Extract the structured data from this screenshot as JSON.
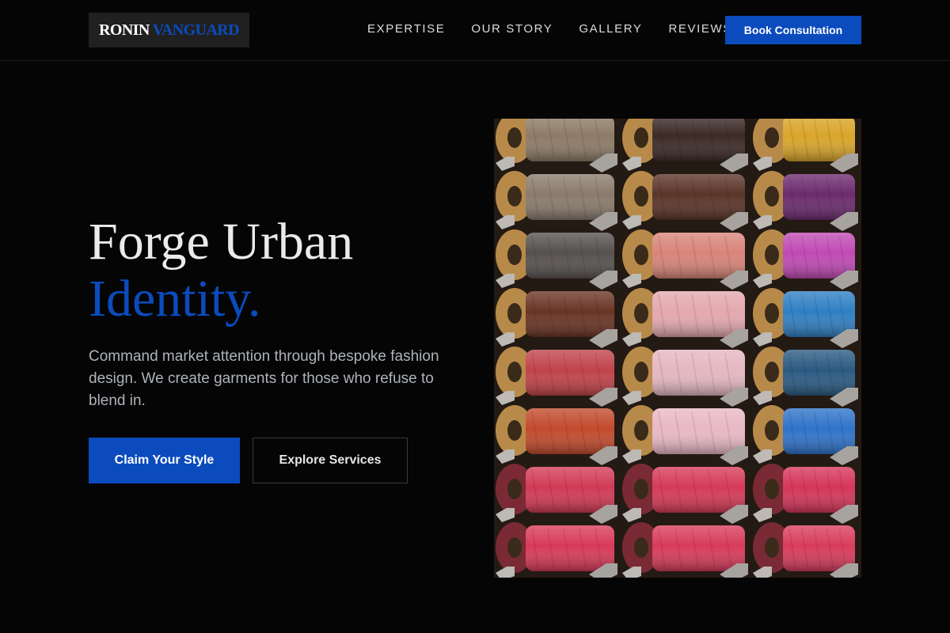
{
  "brand": {
    "part1": "RONIN",
    "part2": "VANGUARD",
    "accent_color": "#0b4bbd"
  },
  "nav": {
    "items": [
      {
        "label": "EXPERTISE"
      },
      {
        "label": "OUR STORY"
      },
      {
        "label": "GALLERY"
      },
      {
        "label": "REVIEWS"
      }
    ],
    "cta_label": "Book Consultation"
  },
  "hero": {
    "title_line1": "Forge Urban",
    "title_line2": "Identity.",
    "subtitle": "Command market attention through bespoke fashion design. We create garments for those who refuse to blend in.",
    "primary_cta": "Claim Your Style",
    "secondary_cta": "Explore Services",
    "image_subject": "spools-of-colored-thread-photo"
  },
  "colors": {
    "background": "#050505",
    "accent": "#0b4bbd",
    "text": "#ebebeb",
    "muted_text": "#aeb2ba"
  }
}
